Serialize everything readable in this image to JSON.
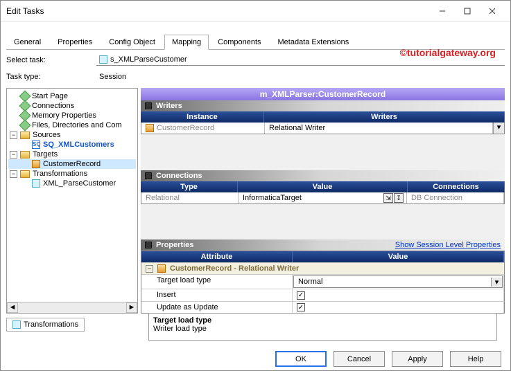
{
  "window": {
    "title": "Edit Tasks"
  },
  "tabs": [
    "General",
    "Properties",
    "Config Object",
    "Mapping",
    "Components",
    "Metadata Extensions"
  ],
  "activeTab": "Mapping",
  "form": {
    "select_task_label": "Select task:",
    "select_task_value": "s_XMLParseCustomer",
    "task_type_label": "Task type:",
    "task_type_value": "Session"
  },
  "watermark": "©tutorialgateway.org",
  "tree": {
    "start_page": "Start Page",
    "connections": "Connections",
    "memory_properties": "Memory Properties",
    "files_dirs": "Files, Directories and Com",
    "sources": "Sources",
    "source_item": "SQ_XMLCustomers",
    "targets": "Targets",
    "target_item": "CustomerRecord",
    "transformations": "Transformations",
    "xform_item": "XML_ParseCustomer"
  },
  "trans_tab": "Transformations",
  "right": {
    "mapping_name": "m_XMLParser:CustomerRecord",
    "writers_title": "Writers",
    "writers_cols": {
      "instance": "Instance",
      "writers": "Writers"
    },
    "writers_row": {
      "instance": "CustomerRecord",
      "writer": "Relational Writer"
    },
    "conns_title": "Connections",
    "conns_cols": {
      "type": "Type",
      "value": "Value",
      "connections": "Connections"
    },
    "conns_row": {
      "type": "Relational",
      "value": "InformaticaTarget",
      "connections": "DB Connection"
    },
    "props_title": "Properties",
    "show_session_link": "Show Session Level Properties",
    "props_cols": {
      "attribute": "Attribute",
      "value": "Value"
    },
    "props_group": "CustomerRecord - Relational Writer",
    "props_rows": {
      "r1_attr": "Target load type",
      "r1_val": "Normal",
      "r2_attr": "Insert",
      "r3_attr": "Update as Update"
    }
  },
  "description": {
    "title": "Target load type",
    "body": "Writer load type"
  },
  "buttons": {
    "ok": "OK",
    "cancel": "Cancel",
    "apply": "Apply",
    "help": "Help"
  }
}
